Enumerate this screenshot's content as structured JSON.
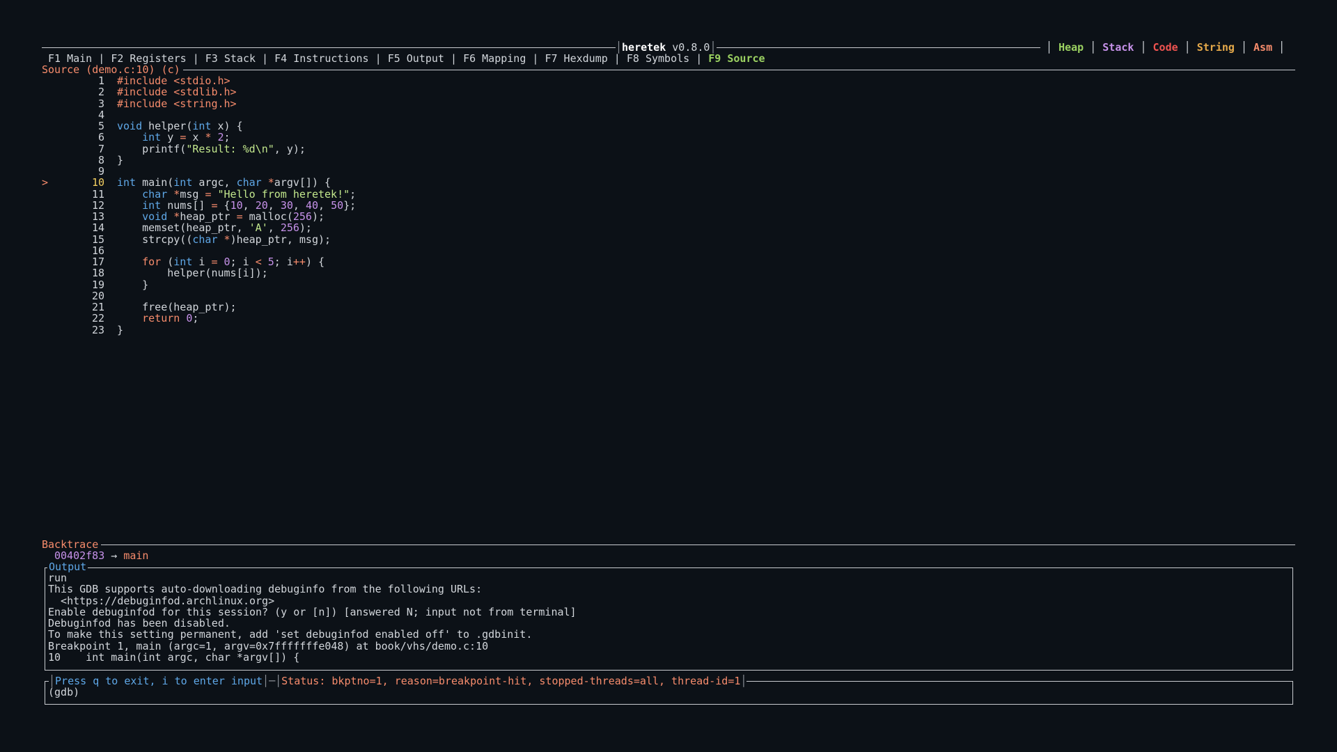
{
  "app": {
    "name": "heretek",
    "version": "v0.8.0"
  },
  "legend": [
    {
      "label": "Heap",
      "cls": "l-heap"
    },
    {
      "label": "Stack",
      "cls": "l-stack"
    },
    {
      "label": "Code",
      "cls": "l-code"
    },
    {
      "label": "String",
      "cls": "l-string"
    },
    {
      "label": "Asm",
      "cls": "l-asm"
    }
  ],
  "tabs": [
    {
      "key": "F1",
      "label": "F1 Main",
      "active": false
    },
    {
      "key": "F2",
      "label": "F2 Registers",
      "active": false
    },
    {
      "key": "F3",
      "label": "F3 Stack",
      "active": false
    },
    {
      "key": "F4",
      "label": "F4 Instructions",
      "active": false
    },
    {
      "key": "F5",
      "label": "F5 Output",
      "active": false
    },
    {
      "key": "F6",
      "label": "F6 Mapping",
      "active": false
    },
    {
      "key": "F7",
      "label": "F7 Hexdump",
      "active": false
    },
    {
      "key": "F8",
      "label": "F8 Symbols",
      "active": false
    },
    {
      "key": "F9",
      "label": "F9 Source",
      "active": true
    }
  ],
  "source": {
    "title": "Source (demo.c:10) (c)",
    "current_line": 10,
    "marker": ">",
    "lines": [
      [
        [
          "pp",
          "#include <stdio.h>"
        ]
      ],
      [
        [
          "pp",
          "#include <stdlib.h>"
        ]
      ],
      [
        [
          "pp",
          "#include <string.h>"
        ]
      ],
      [],
      [
        [
          "kw",
          "void"
        ],
        [
          "code",
          " helper("
        ],
        [
          "kw",
          "int"
        ],
        [
          "code",
          " x) {"
        ]
      ],
      [
        [
          "code",
          "    "
        ],
        [
          "kw",
          "int"
        ],
        [
          "code",
          " y "
        ],
        [
          "op",
          "="
        ],
        [
          "code",
          " x "
        ],
        [
          "op",
          "*"
        ],
        [
          "code",
          " "
        ],
        [
          "num",
          "2"
        ],
        [
          "code",
          ";"
        ]
      ],
      [
        [
          "code",
          "    printf("
        ],
        [
          "str",
          "\"Result: %d\\n\""
        ],
        [
          "code",
          ", y);"
        ]
      ],
      [
        [
          "code",
          "}"
        ]
      ],
      [],
      [
        [
          "kw",
          "int"
        ],
        [
          "code",
          " main("
        ],
        [
          "kw",
          "int"
        ],
        [
          "code",
          " argc, "
        ],
        [
          "kw",
          "char"
        ],
        [
          "code",
          " "
        ],
        [
          "op",
          "*"
        ],
        [
          "code",
          "argv[]) {"
        ]
      ],
      [
        [
          "code",
          "    "
        ],
        [
          "kw",
          "char"
        ],
        [
          "code",
          " "
        ],
        [
          "op",
          "*"
        ],
        [
          "code",
          "msg "
        ],
        [
          "op",
          "="
        ],
        [
          "code",
          " "
        ],
        [
          "str",
          "\"Hello from heretek!\""
        ],
        [
          "code",
          ";"
        ]
      ],
      [
        [
          "code",
          "    "
        ],
        [
          "kw",
          "int"
        ],
        [
          "code",
          " nums[] "
        ],
        [
          "op",
          "="
        ],
        [
          "code",
          " {"
        ],
        [
          "num",
          "10"
        ],
        [
          "code",
          ", "
        ],
        [
          "num",
          "20"
        ],
        [
          "code",
          ", "
        ],
        [
          "num",
          "30"
        ],
        [
          "code",
          ", "
        ],
        [
          "num",
          "40"
        ],
        [
          "code",
          ", "
        ],
        [
          "num",
          "50"
        ],
        [
          "code",
          "};"
        ]
      ],
      [
        [
          "code",
          "    "
        ],
        [
          "kw",
          "void"
        ],
        [
          "code",
          " "
        ],
        [
          "op",
          "*"
        ],
        [
          "code",
          "heap_ptr "
        ],
        [
          "op",
          "="
        ],
        [
          "code",
          " malloc("
        ],
        [
          "num",
          "256"
        ],
        [
          "code",
          ");"
        ]
      ],
      [
        [
          "code",
          "    memset(heap_ptr, "
        ],
        [
          "str",
          "'A'"
        ],
        [
          "code",
          ", "
        ],
        [
          "num",
          "256"
        ],
        [
          "code",
          ");"
        ]
      ],
      [
        [
          "code",
          "    strcpy(("
        ],
        [
          "kw",
          "char"
        ],
        [
          "code",
          " "
        ],
        [
          "op",
          "*"
        ],
        [
          "code",
          ")heap_ptr, msg);"
        ]
      ],
      [],
      [
        [
          "code",
          "    "
        ],
        [
          "kw2",
          "for"
        ],
        [
          "code",
          " ("
        ],
        [
          "kw",
          "int"
        ],
        [
          "code",
          " i "
        ],
        [
          "op",
          "="
        ],
        [
          "code",
          " "
        ],
        [
          "num",
          "0"
        ],
        [
          "code",
          "; i "
        ],
        [
          "op",
          "<"
        ],
        [
          "code",
          " "
        ],
        [
          "num",
          "5"
        ],
        [
          "code",
          "; i"
        ],
        [
          "op",
          "++"
        ],
        [
          "code",
          ") {"
        ]
      ],
      [
        [
          "code",
          "        helper(nums[i]);"
        ]
      ],
      [
        [
          "code",
          "    }"
        ]
      ],
      [],
      [
        [
          "code",
          "    free(heap_ptr);"
        ]
      ],
      [
        [
          "code",
          "    "
        ],
        [
          "kw2",
          "return"
        ],
        [
          "code",
          " "
        ],
        [
          "num",
          "0"
        ],
        [
          "code",
          ";"
        ]
      ],
      [
        [
          "code",
          "}"
        ]
      ]
    ]
  },
  "backtrace": {
    "title": "Backtrace",
    "address": "00402f83",
    "arrow": "→",
    "function": "main"
  },
  "output": {
    "title": "Output",
    "lines": [
      "run",
      "This GDB supports auto-downloading debuginfo from the following URLs:",
      "  <https://debuginfod.archlinux.org>",
      "Enable debuginfod for this session? (y or [n]) [answered N; input not from terminal]",
      "Debuginfod has been disabled.",
      "To make this setting permanent, add 'set debuginfod enabled off' to .gdbinit.",
      "Breakpoint 1, main (argc=1, argv=0x7fffffffe048) at book/vhs/demo.c:10",
      "10    int main(int argc, char *argv[]) {"
    ]
  },
  "prompt": {
    "hint": "Press q to exit, i to enter input",
    "status": "Status: bkptno=1, reason=breakpoint-hit, stopped-threads=all, thread-id=1",
    "input": "(gdb)"
  }
}
